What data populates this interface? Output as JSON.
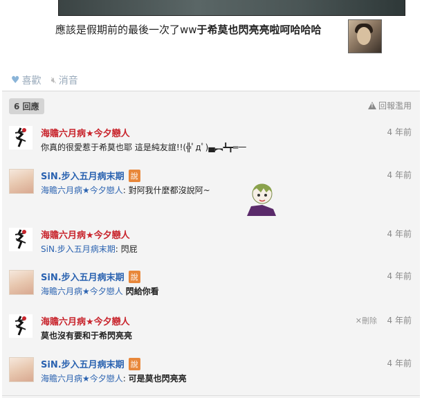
{
  "post": {
    "text_normal": "應該是假期前的最後一次了ww",
    "text_bold": "于希莫也閃亮亮啦呵哈哈哈"
  },
  "actions": {
    "like_label": "喜歡",
    "mute_label": "消音"
  },
  "comments_header": {
    "count_label": "6 回應",
    "report_label": "回報濫用"
  },
  "comments": [
    {
      "author": "海贍六月病★今夕戀人",
      "author_color": "#c8242c",
      "badge": "",
      "time": "4 年前",
      "mention": "",
      "text": "你真的很愛惹于希莫也耶 這是純友誼!!(╬ﾟдﾟ)▄︻┻┳═一"
    },
    {
      "author": "SiN.步入五月病末期",
      "author_color": "#2a62b0",
      "badge": "說",
      "time": "4 年前",
      "mention": "海贍六月病★今夕戀人",
      "text": ": 對阿我什麼都沒說阿~"
    },
    {
      "author": "海贍六月病★今夕戀人",
      "author_color": "#c8242c",
      "badge": "",
      "time": "4 年前",
      "mention": "SiN.步入五月病末期",
      "text": ": 閃屁"
    },
    {
      "author": "SiN.步入五月病末期",
      "author_color": "#2a62b0",
      "badge": "說",
      "time": "4 年前",
      "mention": "海贍六月病★今夕戀人",
      "text": "閃給你看"
    },
    {
      "author": "海贍六月病★今夕戀人",
      "author_color": "#c8242c",
      "badge": "",
      "time": "4 年前",
      "delete_label": "刪除",
      "mention": "",
      "text": "莫也沒有要和于希閃亮亮"
    },
    {
      "author": "SiN.步入五月病末期",
      "author_color": "#2a62b0",
      "badge": "說",
      "time": "4 年前",
      "mention": "海贍六月病★今夕戀人",
      "text": "可是莫也閃亮亮"
    }
  ]
}
